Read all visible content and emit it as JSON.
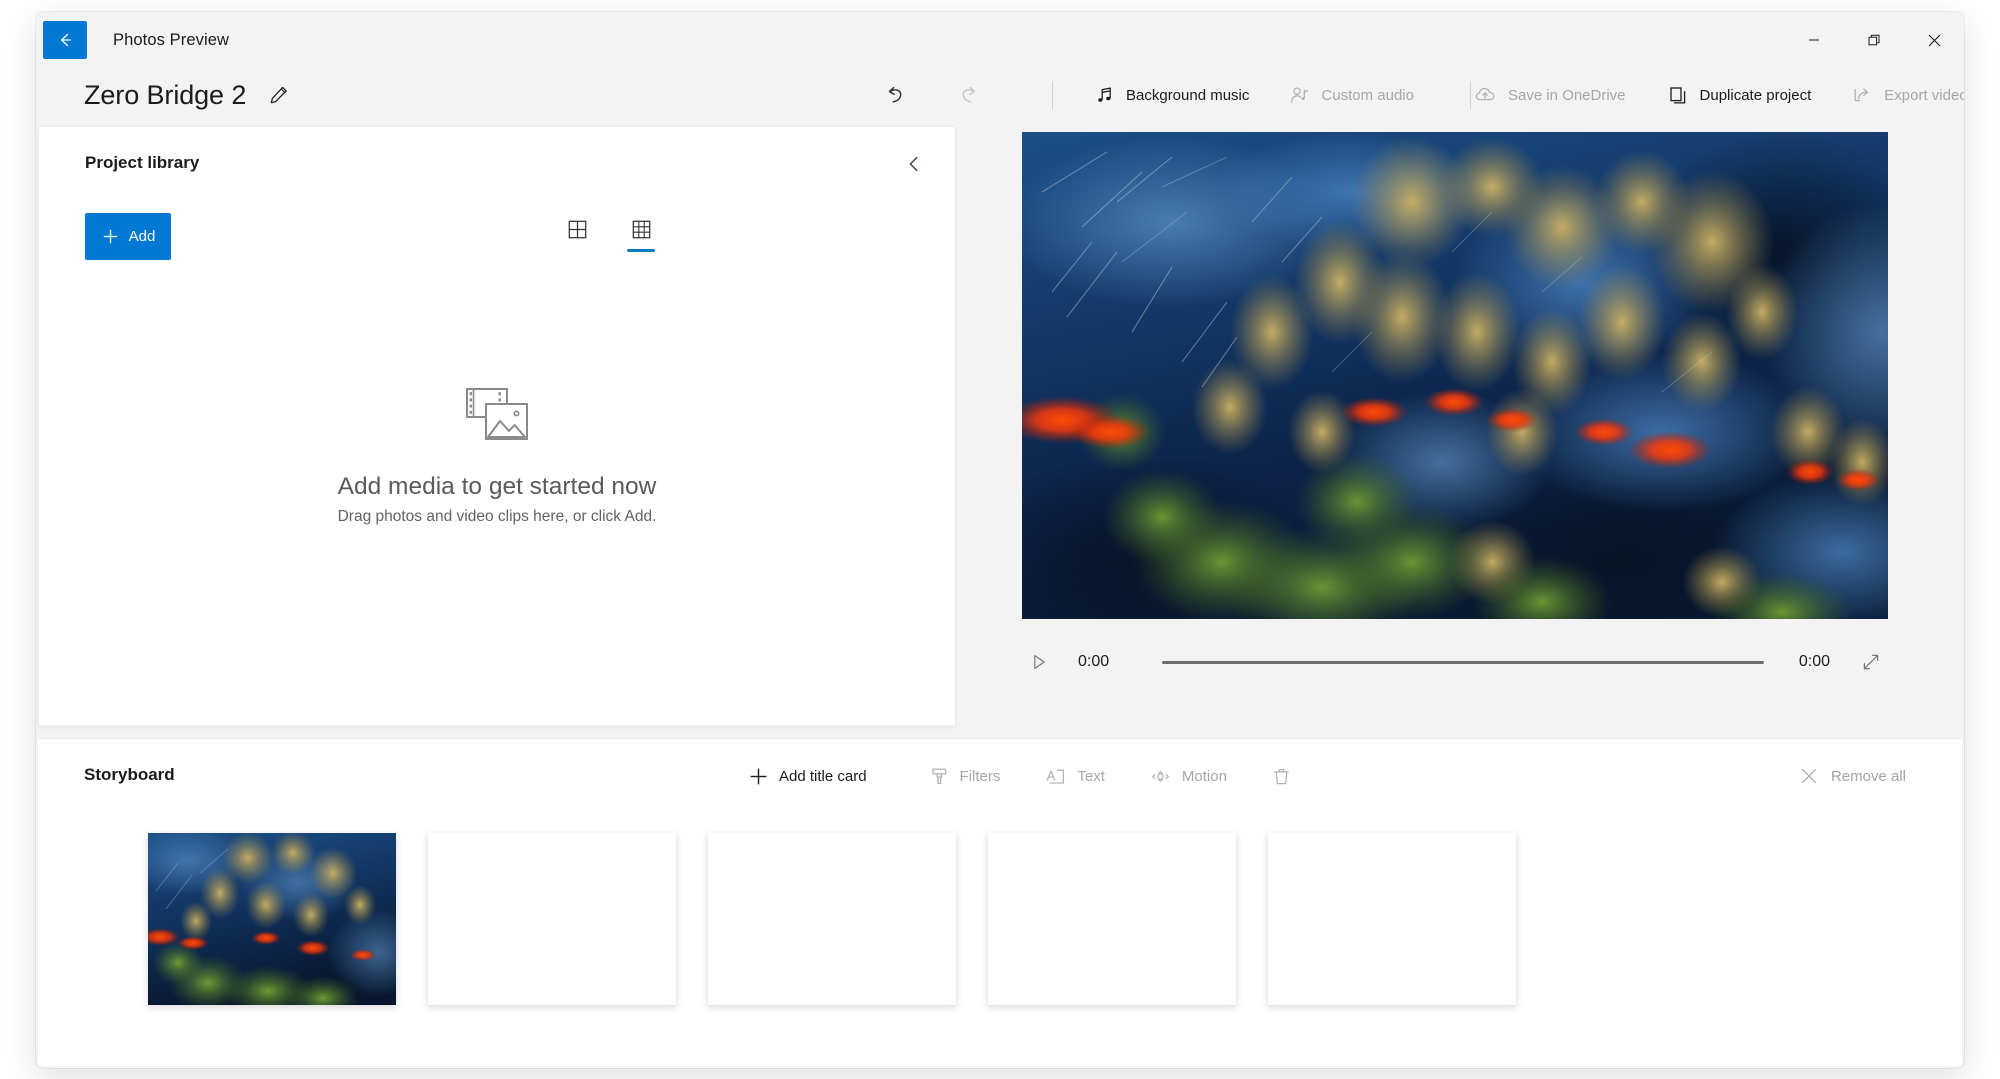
{
  "window": {
    "app_name": "Photos Preview",
    "back_icon": "back-arrow-icon",
    "minimize_label": "Minimize",
    "maximize_label": "Restore",
    "close_label": "Close"
  },
  "commandbar": {
    "project_name": "Zero Bridge 2",
    "rename_icon": "pencil-icon",
    "undo_icon": "undo-icon",
    "redo_icon": "redo-icon",
    "tools": [
      {
        "label": "Background music",
        "icon": "music-note-icon",
        "enabled": true
      },
      {
        "label": "Custom audio",
        "icon": "person-audio-icon",
        "enabled": false
      },
      {
        "label": "Save in OneDrive",
        "icon": "cloud-upload-icon",
        "enabled": false
      },
      {
        "label": "Duplicate project",
        "icon": "copy-icon",
        "enabled": true
      },
      {
        "label": "Export video",
        "icon": "share-export-icon",
        "enabled": false
      }
    ],
    "more_label": "• • •"
  },
  "library": {
    "title": "Project library",
    "collapse_icon": "chevron-left-icon",
    "add_label": "Add",
    "add_icon": "plus-icon",
    "views": [
      {
        "name": "large-thumbnail-view",
        "icon": "grid-2x2-icon",
        "active": false
      },
      {
        "name": "small-thumbnail-view",
        "icon": "grid-3x3-icon",
        "active": true
      }
    ],
    "empty_state": {
      "icon": "media-placeholder-icon",
      "title": "Add media to get started now",
      "subtitle": "Drag photos and video clips here, or click Add."
    }
  },
  "preview": {
    "play_icon": "play-triangle-icon",
    "current_time": "0:00",
    "total_time": "0:00",
    "fullscreen_icon": "expand-diagonal-icon",
    "progress_percent": 0
  },
  "storyboard": {
    "title": "Storyboard",
    "tools": [
      {
        "label": "Add title card",
        "icon": "plus-icon",
        "enabled": true
      },
      {
        "label": "Filters",
        "icon": "brush-icon",
        "enabled": false
      },
      {
        "label": "Text",
        "icon": "text-box-icon",
        "enabled": false
      },
      {
        "label": "Motion",
        "icon": "motion-arrows-icon",
        "enabled": false
      },
      {
        "label": "",
        "icon": "trash-icon",
        "enabled": false
      }
    ],
    "remove_all_label": "Remove all",
    "remove_all_icon": "close-x-icon",
    "cards": [
      {
        "name": "storyboard-card-1",
        "filled": true
      },
      {
        "name": "storyboard-card-2",
        "filled": false
      },
      {
        "name": "storyboard-card-3",
        "filled": false
      },
      {
        "name": "storyboard-card-4",
        "filled": false
      },
      {
        "name": "storyboard-card-5",
        "filled": false
      }
    ]
  },
  "colors": {
    "accent": "#0078d4",
    "accent_underline": "#0f7cbf",
    "window_background": "#f3f3f3",
    "card_background": "#ffffff",
    "text_primary": "#1b1b1b",
    "text_disabled": "#a6a6a6"
  }
}
